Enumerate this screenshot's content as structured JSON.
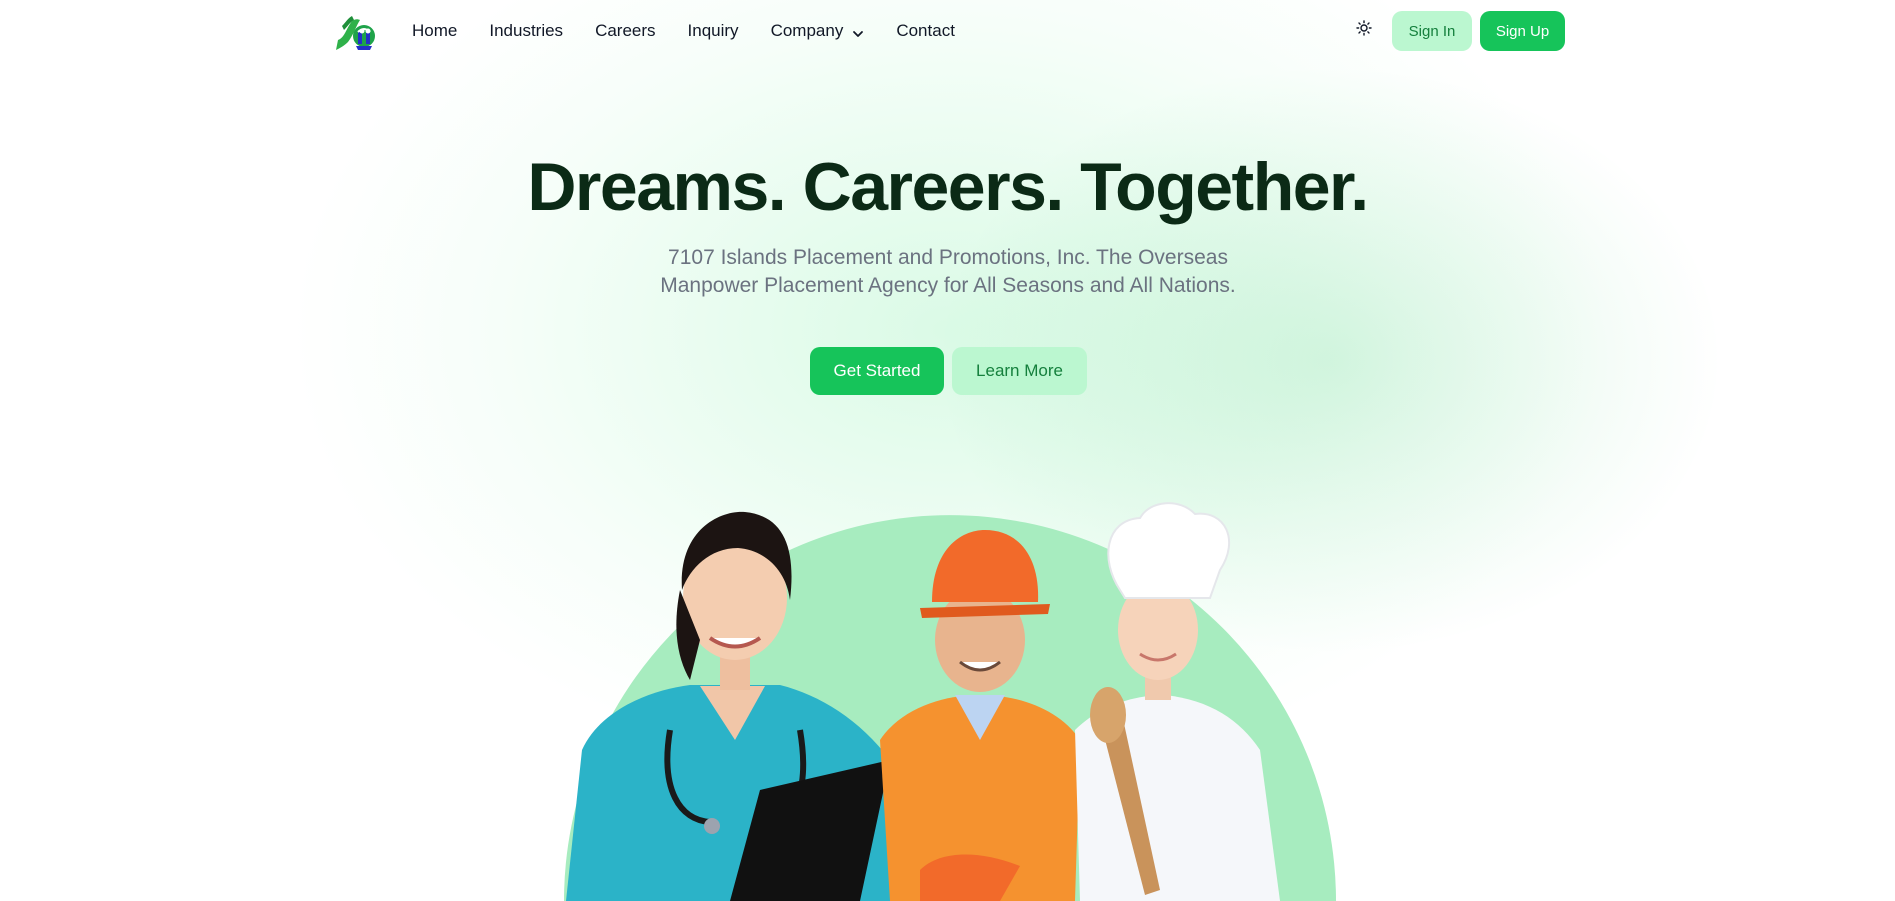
{
  "brand": {
    "logo_icon": "company-logo-icon",
    "accent_color": "#16c45a",
    "accent_light": "#bbf7d0",
    "heading_color": "#0b2a16"
  },
  "nav": {
    "items": [
      {
        "label": "Home"
      },
      {
        "label": "Industries"
      },
      {
        "label": "Careers"
      },
      {
        "label": "Inquiry"
      },
      {
        "label": "Company",
        "has_dropdown": true,
        "icon": "chevron-down-icon"
      },
      {
        "label": "Contact"
      }
    ],
    "theme_toggle_icon": "sun-icon",
    "sign_in_label": "Sign In",
    "sign_up_label": "Sign Up"
  },
  "hero": {
    "title": "Dreams. Careers. Together.",
    "subtitle": "7107 Islands Placement and Promotions, Inc. The Overseas Manpower Placement Agency for All Seasons and All Nations.",
    "primary_cta": "Get Started",
    "secondary_cta": "Learn More"
  }
}
